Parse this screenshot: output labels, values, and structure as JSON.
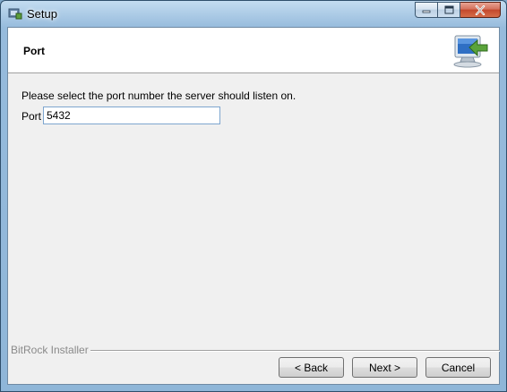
{
  "window": {
    "title": "Setup",
    "minimize_icon": "minimize-icon",
    "maximize_icon": "maximize-icon",
    "close_icon": "close-icon"
  },
  "header": {
    "title": "Port",
    "icon": "computer-arrow-icon"
  },
  "body": {
    "instruction": "Please select the port number the server should listen on.",
    "port_label": "Port",
    "port_value": "5432"
  },
  "footer": {
    "brand": "BitRock Installer",
    "back_label": "< Back",
    "next_label": "Next >",
    "cancel_label": "Cancel"
  },
  "colors": {
    "accent": "#7ea6cf",
    "close_red": "#c3482c",
    "client_bg": "#f0f0f0"
  }
}
